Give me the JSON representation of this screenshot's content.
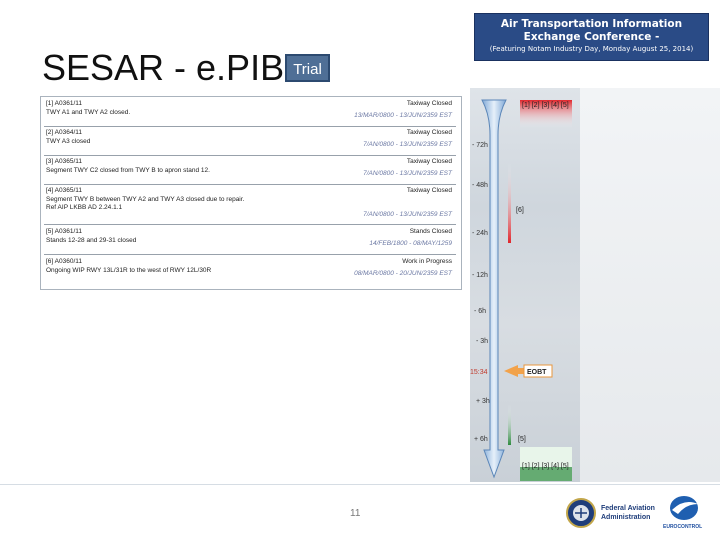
{
  "banner": {
    "line1": "Air Transportation Information",
    "line2": "Exchange Conference -",
    "line3": "(Featuring Notam Industry Day, Monday August 25, 2014)"
  },
  "title": "SESAR - e.PIB",
  "trial_label": "Trial",
  "notams": [
    {
      "id": "[1] A0361/11",
      "type": "Taxiway Closed",
      "text": [
        "TWY A1 and TWY A2 closed."
      ],
      "period": "13/MAR/0800 - 13/JUN/2359 EST"
    },
    {
      "id": "[2] A0364/11",
      "type": "Taxiway Closed",
      "text": [
        "TWY A3 closed"
      ],
      "period": "7/AN/0800 - 13/JUN/2359 EST"
    },
    {
      "id": "[3] A0365/11",
      "type": "Taxiway Closed",
      "text": [
        "Segment TWY C2 closed from TWY B to apron stand 12."
      ],
      "period": "7/AN/0800 - 13/JUN/2359 EST"
    },
    {
      "id": "[4] A0365/11",
      "type": "Taxiway Closed",
      "text": [
        "Segment TWY B between TWY A2 and TWY A3 closed due to repair.",
        "Ref AIP LKBB AD 2.24.1.1"
      ],
      "period": "7/AN/0800 - 13/JUN/2359 EST"
    },
    {
      "id": "[5] A0361/11",
      "type": "Stands Closed",
      "text": [
        "Stands 12-28 and 29-31 closed"
      ],
      "period": "14/FEB/1800 - 08/MAY/1259"
    },
    {
      "id": "[6] A0360/11",
      "type": "Work in Progress",
      "text": [
        "Ongoing WIP RWY 13L/31R to the west of RWY 12L/30R"
      ],
      "period": "08/MAR/0800 - 20/JUN/2359 EST"
    }
  ],
  "timeline": {
    "ticks": [
      "- 72h",
      "- 48h",
      "- 24h",
      "- 12h",
      "- 6h",
      "- 3h",
      "15:34",
      "+ 3h",
      "+ 6h"
    ],
    "eobt_label": "EOBT",
    "top_markers": "[1] [2] [3] [4] [5]",
    "marker_6": "[6]",
    "marker_5": "[5]",
    "bottom_markers": "[1] [2] [3] [4] [5]"
  },
  "page_number": "11",
  "footer": {
    "faa_line1": "Federal Aviation",
    "faa_line2": "Administration",
    "euro_text": "EUROCONTROL"
  },
  "colors": {
    "banner": "#2a4b86",
    "trial": "#4f6f96",
    "arrow": "#a9c6e8",
    "red": "#e0262c",
    "green": "#2e8b3e"
  }
}
